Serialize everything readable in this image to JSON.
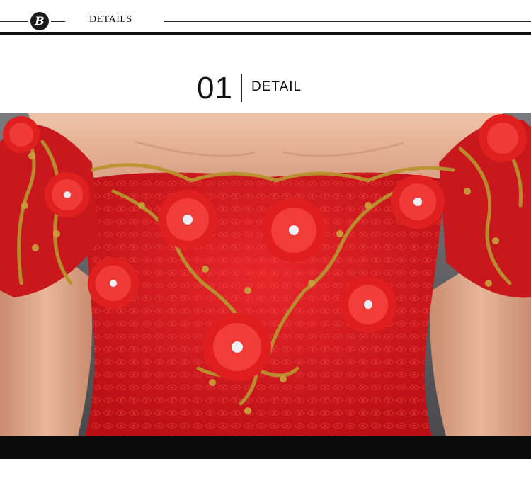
{
  "header": {
    "logo_letter": "B",
    "title": "DETAILS"
  },
  "section": {
    "number": "01",
    "label": "DETAIL"
  },
  "photo": {
    "subject": "dress-lace-bodice-photo"
  },
  "colors": {
    "dress_red": "#d4161c",
    "gold_embroidery": "#b8922e",
    "skin": "#e6b49a",
    "background_gray": "#6f6f72"
  }
}
